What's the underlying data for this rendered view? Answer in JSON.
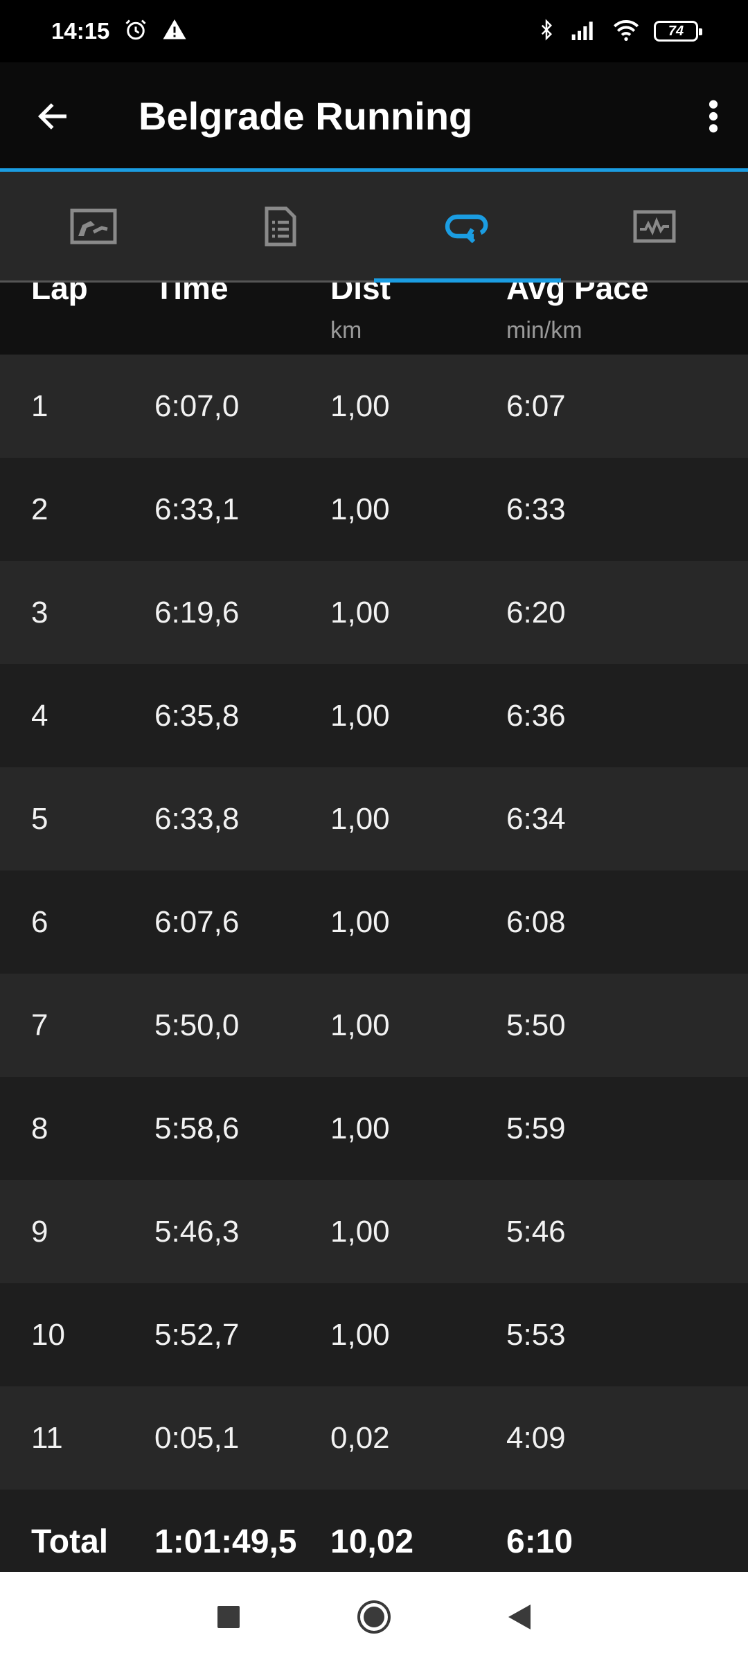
{
  "status_bar": {
    "time": "14:15",
    "battery": "74"
  },
  "app_bar": {
    "title": "Belgrade Running"
  },
  "tabs": [
    {
      "name": "overview",
      "icon": "map-summary-icon",
      "active": false
    },
    {
      "name": "details",
      "icon": "document-list-icon",
      "active": false
    },
    {
      "name": "laps",
      "icon": "laps-loop-icon",
      "active": true
    },
    {
      "name": "charts",
      "icon": "chart-pulse-icon",
      "active": false
    }
  ],
  "table": {
    "headers": [
      {
        "label": "Lap",
        "unit": ""
      },
      {
        "label": "Time",
        "unit": ""
      },
      {
        "label": "Dist",
        "unit": "km"
      },
      {
        "label": "Avg Pace",
        "unit": "min/km"
      }
    ],
    "rows": [
      [
        "1",
        "6:07,0",
        "1,00",
        "6:07"
      ],
      [
        "2",
        "6:33,1",
        "1,00",
        "6:33"
      ],
      [
        "3",
        "6:19,6",
        "1,00",
        "6:20"
      ],
      [
        "4",
        "6:35,8",
        "1,00",
        "6:36"
      ],
      [
        "5",
        "6:33,8",
        "1,00",
        "6:34"
      ],
      [
        "6",
        "6:07,6",
        "1,00",
        "6:08"
      ],
      [
        "7",
        "5:50,0",
        "1,00",
        "5:50"
      ],
      [
        "8",
        "5:58,6",
        "1,00",
        "5:59"
      ],
      [
        "9",
        "5:46,3",
        "1,00",
        "5:46"
      ],
      [
        "10",
        "5:52,7",
        "1,00",
        "5:53"
      ],
      [
        "11",
        "0:05,1",
        "0,02",
        "4:09"
      ]
    ],
    "total": [
      "Total",
      "1:01:49,5",
      "10,02",
      "6:10"
    ]
  },
  "colors": {
    "accent": "#1b9de2",
    "row_odd": "#282828",
    "row_even": "#1e1e1e"
  }
}
